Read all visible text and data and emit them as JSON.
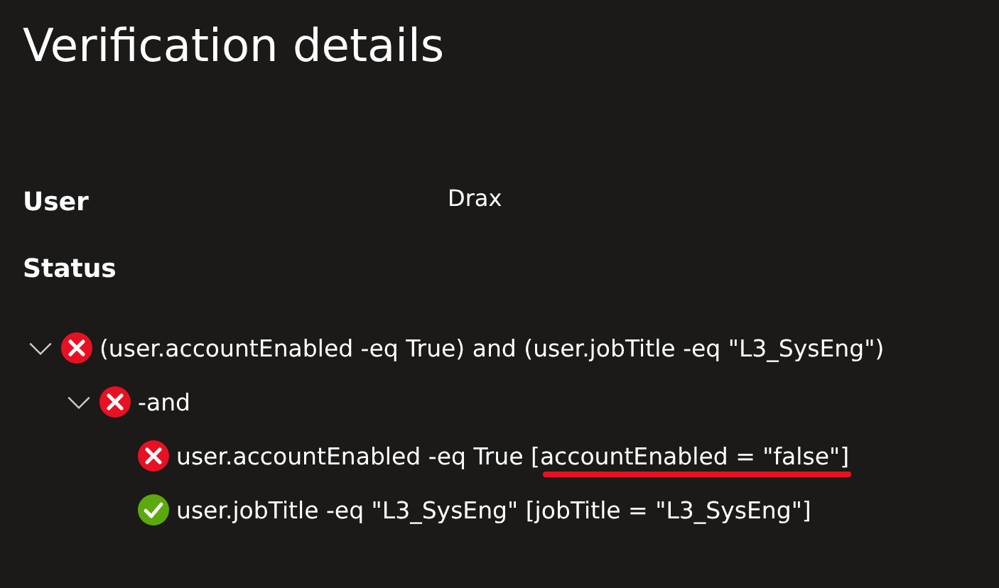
{
  "title": "Verification details",
  "fields": [
    {
      "label": "User",
      "value": "Drax"
    }
  ],
  "status": {
    "label": "Status",
    "tree": [
      {
        "kind": "fail",
        "expanded": true,
        "text": "(user.accountEnabled -eq True) and (user.jobTitle -eq \"L3_SysEng\")",
        "children": [
          {
            "kind": "fail",
            "expanded": true,
            "text": "-and",
            "children": [
              {
                "kind": "fail",
                "text": "user.accountEnabled -eq True [",
                "annotated": "accountEnabled = \"false\"",
                "tail": "]"
              },
              {
                "kind": "pass",
                "text": "user.jobTitle -eq \"L3_SysEng\" [jobTitle = \"L3_SysEng\"]"
              }
            ]
          }
        ]
      }
    ]
  }
}
